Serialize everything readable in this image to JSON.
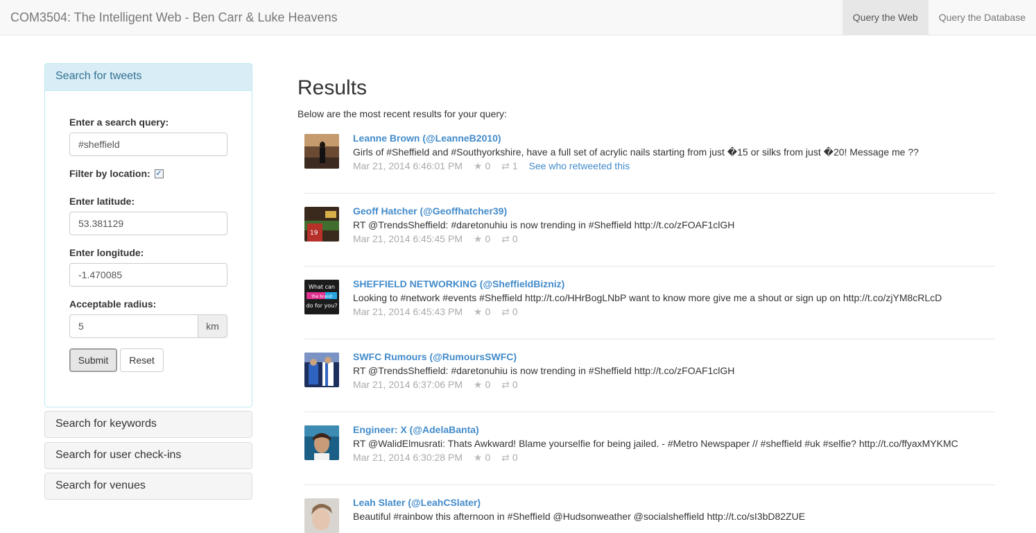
{
  "navbar": {
    "brand": "COM3504: The Intelligent Web - Ben Carr & Luke Heavens",
    "links": [
      "Query the Web",
      "Query the Database"
    ]
  },
  "sidebar": {
    "active_panel": {
      "title": "Search for tweets",
      "query_label": "Enter a search query:",
      "query_value": "#sheffield",
      "filter_label": "Filter by location:",
      "filter_checked": true,
      "lat_label": "Enter latitude:",
      "lat_value": "53.381129",
      "lon_label": "Enter longitude:",
      "lon_value": "-1.470085",
      "radius_label": "Acceptable radius:",
      "radius_value": "5",
      "radius_unit": "km",
      "submit_label": "Submit",
      "reset_label": "Reset"
    },
    "collapsed_panels": [
      "Search for keywords",
      "Search for user check-ins",
      "Search for venues"
    ]
  },
  "results": {
    "title": "Results",
    "subtitle": "Below are the most recent results for your query:",
    "tweets": [
      {
        "name": "Leanne Brown (@LeanneB2010)",
        "text": "Girls of #Sheffield and #Southyorkshire, have a full set of acrylic nails starting from just �15 or silks from just �20! Message me ??",
        "time": "Mar 21, 2014 6:46:01 PM",
        "favorites": "0",
        "retweets": "1",
        "retweet_link": "See who retweeted this"
      },
      {
        "name": "Geoff Hatcher (@Geoffhatcher39)",
        "text": "RT @TrendsSheffield: #daretonuhiu is now trending in #Sheffield http://t.co/zFOAF1clGH",
        "time": "Mar 21, 2014 6:45:45 PM",
        "favorites": "0",
        "retweets": "0"
      },
      {
        "name": "SHEFFIELD NETWORKING (@SheffieldBizniz)",
        "text": "Looking to #network #events #Sheffield http://t.co/HHrBogLNbP want to know more give me a shout or sign up on http://t.co/zjYM8cRLcD",
        "time": "Mar 21, 2014 6:45:43 PM",
        "favorites": "0",
        "retweets": "0"
      },
      {
        "name": "SWFC Rumours (@RumoursSWFC)",
        "text": "RT @TrendsSheffield: #daretonuhiu is now trending in #Sheffield http://t.co/zFOAF1clGH",
        "time": "Mar 21, 2014 6:37:06 PM",
        "favorites": "0",
        "retweets": "0"
      },
      {
        "name": "Engineer: X (@AdelaBanta)",
        "text": "RT @WalidElmusrati: Thats Awkward! Blame yourselfie for being jailed. - #Metro Newspaper // #sheffield #uk #selfie? http://t.co/ffyaxMYKMC",
        "time": "Mar 21, 2014 6:30:28 PM",
        "favorites": "0",
        "retweets": "0"
      },
      {
        "name": "Leah Slater (@LeahCSlater)",
        "text": "Beautiful #rainbow this afternoon in #Sheffield @Hudsonweather @socialsheffield http://t.co/sI3bD82ZUE",
        "time": "",
        "favorites": "",
        "retweets": ""
      }
    ],
    "avatar_text": {
      "networking": [
        "What can",
        "the brand",
        "do for you?"
      ]
    }
  },
  "icons": {
    "favorite": "star-icon",
    "retweet": "retweet-icon"
  },
  "colors": {
    "link": "#428bca",
    "panel_heading_bg": "#d9edf7",
    "panel_heading_text": "#31708f"
  }
}
